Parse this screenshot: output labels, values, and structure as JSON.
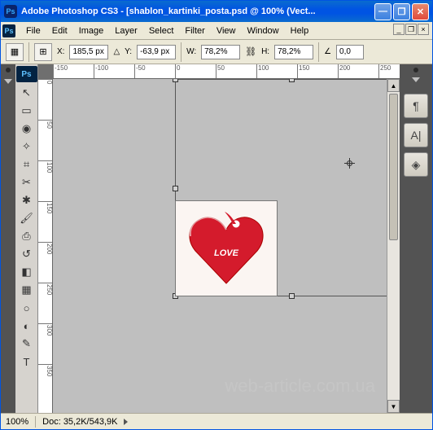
{
  "titlebar": {
    "app_icon_text": "Ps",
    "title": "Adobe Photoshop CS3 - [shablon_kartinki_posta.psd @ 100% (Vect..."
  },
  "menu": {
    "ps": "Ps",
    "items": [
      "File",
      "Edit",
      "Image",
      "Layer",
      "Select",
      "Filter",
      "View",
      "Window",
      "Help"
    ]
  },
  "options": {
    "x_label": "X:",
    "x_value": "185,5 px",
    "y_label": "Y:",
    "y_value": "-63,9 px",
    "w_label": "W:",
    "w_value": "78,2%",
    "h_label": "H:",
    "h_value": "78,2%",
    "angle_label": "∠",
    "angle_value": "0,0"
  },
  "tools": [
    {
      "name": "move-tool",
      "glyph": "↖"
    },
    {
      "name": "marquee-tool",
      "glyph": "▭"
    },
    {
      "name": "lasso-tool",
      "glyph": "◉"
    },
    {
      "name": "magic-wand-tool",
      "glyph": "✧"
    },
    {
      "name": "crop-tool",
      "glyph": "⌗"
    },
    {
      "name": "slice-tool",
      "glyph": "✂"
    },
    {
      "name": "healing-brush-tool",
      "glyph": "✱"
    },
    {
      "name": "brush-tool",
      "glyph": "🖌"
    },
    {
      "name": "clone-stamp-tool",
      "glyph": "⎙"
    },
    {
      "name": "history-brush-tool",
      "glyph": "↺"
    },
    {
      "name": "eraser-tool",
      "glyph": "◧"
    },
    {
      "name": "gradient-tool",
      "glyph": "▦"
    },
    {
      "name": "blur-tool",
      "glyph": "○"
    },
    {
      "name": "dodge-tool",
      "glyph": "◐"
    },
    {
      "name": "pen-tool",
      "glyph": "✎"
    },
    {
      "name": "type-tool",
      "glyph": "T"
    }
  ],
  "ruler_h": [
    "-150",
    "-100",
    "-50",
    "0",
    "50",
    "100",
    "150",
    "200",
    "250"
  ],
  "ruler_v": [
    "0",
    "50",
    "100",
    "150",
    "200",
    "250",
    "300",
    "350"
  ],
  "heart_text": "LOVE",
  "right_panels": [
    {
      "name": "paragraph-panel",
      "glyph": "¶"
    },
    {
      "name": "character-panel",
      "glyph": "A|"
    },
    {
      "name": "layers-panel",
      "glyph": "◈"
    }
  ],
  "status": {
    "zoom": "100%",
    "doc": "Doc: 35,2K/543,9K"
  },
  "watermark": "web-article.com.ua"
}
